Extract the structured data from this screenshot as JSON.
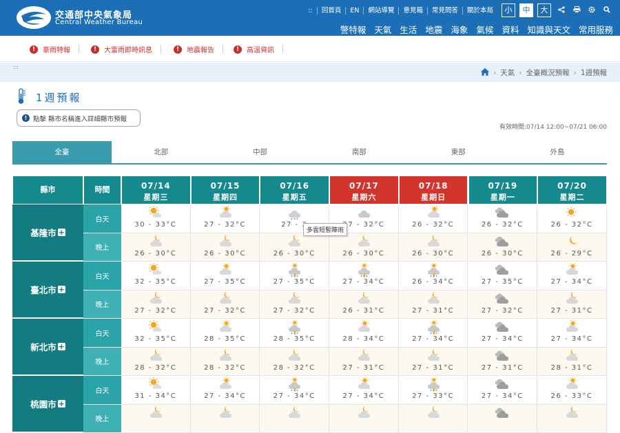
{
  "header": {
    "brand_cn": "交通部中央氣象局",
    "brand_en": "Central Weather Bureau",
    "menu_icon": "::",
    "top_links": [
      "回首頁",
      "EN",
      "網站導覽",
      "意見箱",
      "常見問答",
      "關於本局"
    ],
    "font_sizes": [
      "小",
      "中",
      "大"
    ],
    "font_size_selected": "中",
    "tool_icons": [
      "share-icon",
      "print-icon",
      "gear-icon",
      "search-icon"
    ],
    "nav": [
      "警特報",
      "天氣",
      "生活",
      "地震",
      "海象",
      "氣候",
      "資料",
      "知識與天文",
      "常用服務"
    ],
    "color": "#1c6fb7"
  },
  "alerts": [
    "豪雨特報",
    "大雷雨即時訊息",
    "地震報告",
    "高溫資訊"
  ],
  "breadcrumb": {
    "dots": ":::",
    "items": [
      "天氣",
      "全臺概況預報",
      "1週預報"
    ]
  },
  "page": {
    "title": "1週預報",
    "info_button": "點擊 縣市名稱進入詳細縣市預報",
    "valid_time": "有效時間:07/14 12:00~07/21 06:00"
  },
  "tabs": [
    "全臺",
    "北部",
    "中部",
    "南部",
    "東部",
    "外島"
  ],
  "tab_active": "全臺",
  "table": {
    "col_city": "縣市",
    "col_time": "時間",
    "days": [
      {
        "date": "07/14",
        "weekday": "星期三",
        "holiday": false
      },
      {
        "date": "07/15",
        "weekday": "星期四",
        "holiday": false
      },
      {
        "date": "07/16",
        "weekday": "星期五",
        "holiday": false
      },
      {
        "date": "07/17",
        "weekday": "星期六",
        "holiday": true
      },
      {
        "date": "07/18",
        "weekday": "星期日",
        "holiday": true
      },
      {
        "date": "07/19",
        "weekday": "星期一",
        "holiday": false
      },
      {
        "date": "07/20",
        "weekday": "星期二",
        "holiday": false
      }
    ],
    "day_label": "白天",
    "night_label": "晚上",
    "plus": "+",
    "cities": [
      {
        "name": "基隆市",
        "day": [
          {
            "icon": "sun-cloud",
            "t": "30 - 33°C"
          },
          {
            "icon": "partly-cloudy",
            "t": "27 - 32°C"
          },
          {
            "icon": "cloud-rain",
            "t": "27 - 3"
          },
          {
            "icon": "cloud",
            "t": "27 - 32°C"
          },
          {
            "icon": "partly-cloudy",
            "t": "26 - 32°C"
          },
          {
            "icon": "dark-cloud",
            "t": "26 - 32°C"
          },
          {
            "icon": "sun",
            "t": "26 - 32°C"
          }
        ],
        "night": [
          {
            "icon": "moon-cloud",
            "t": "26 - 30°C"
          },
          {
            "icon": "moon-cloud",
            "t": "26 - 30°C"
          },
          {
            "icon": "moon-cloud",
            "t": "26 - 30°C"
          },
          {
            "icon": "moon-cloud",
            "t": "26 - 30°C"
          },
          {
            "icon": "moon-cloud",
            "t": "26 - 30°C"
          },
          {
            "icon": "dark-cloud",
            "t": "26 - 30°C"
          },
          {
            "icon": "moon",
            "t": "26 - 29°C"
          }
        ]
      },
      {
        "name": "臺北市",
        "day": [
          {
            "icon": "sun-cloud",
            "t": "32 - 35°C"
          },
          {
            "icon": "partly-cloudy",
            "t": "27 - 35°C"
          },
          {
            "icon": "thunder",
            "t": "27 - 35°C"
          },
          {
            "icon": "thunder",
            "t": "27 - 34°C"
          },
          {
            "icon": "thunder",
            "t": "26 - 34°C"
          },
          {
            "icon": "dark-cloud",
            "t": "27 - 35°C"
          },
          {
            "icon": "partly-cloudy",
            "t": "27 - 34°C"
          }
        ],
        "night": [
          {
            "icon": "moon-cloud",
            "t": "27 - 32°C"
          },
          {
            "icon": "moon-cloud",
            "t": "27 - 32°C"
          },
          {
            "icon": "moon-cloud",
            "t": "27 - 32°C"
          },
          {
            "icon": "moon-cloud",
            "t": "26 - 31°C"
          },
          {
            "icon": "moon-cloud",
            "t": "27 - 31°C"
          },
          {
            "icon": "dark-cloud",
            "t": "27 - 32°C"
          },
          {
            "icon": "moon-cloud",
            "t": "27 - 31°C"
          }
        ]
      },
      {
        "name": "新北市",
        "day": [
          {
            "icon": "sun-cloud",
            "t": "32 - 35°C"
          },
          {
            "icon": "partly-cloudy",
            "t": "28 - 35°C"
          },
          {
            "icon": "thunder",
            "t": "28 - 35°C"
          },
          {
            "icon": "partly-cloudy",
            "t": "28 - 34°C"
          },
          {
            "icon": "thunder",
            "t": "27 - 34°C"
          },
          {
            "icon": "dark-cloud",
            "t": "27 - 34°C"
          },
          {
            "icon": "partly-cloudy",
            "t": "27 - 34°C"
          }
        ],
        "night": [
          {
            "icon": "moon-cloud",
            "t": "28 - 32°C"
          },
          {
            "icon": "moon-cloud",
            "t": "28 - 32°C"
          },
          {
            "icon": "moon-cloud",
            "t": "28 - 32°C"
          },
          {
            "icon": "moon-cloud",
            "t": "27 - 31°C"
          },
          {
            "icon": "moon-cloud",
            "t": "27 - 31°C"
          },
          {
            "icon": "dark-cloud",
            "t": "27 - 31°C"
          },
          {
            "icon": "moon-cloud",
            "t": "28 - 31°C"
          }
        ]
      },
      {
        "name": "桃園市",
        "day": [
          {
            "icon": "sun-cloud",
            "t": "31 - 34°C"
          },
          {
            "icon": "partly-cloudy",
            "t": "27 - 34°C"
          },
          {
            "icon": "thunder",
            "t": "27 - 34°C"
          },
          {
            "icon": "partly-cloudy",
            "t": "27 - 34°C"
          },
          {
            "icon": "thunder",
            "t": "27 - 33°C"
          },
          {
            "icon": "dark-cloud",
            "t": "27 - 34°C"
          },
          {
            "icon": "partly-cloudy",
            "t": "26 - 33°C"
          }
        ],
        "night": [
          {
            "icon": "moon-cloud",
            "t": ""
          },
          {
            "icon": "moon-cloud",
            "t": ""
          },
          {
            "icon": "moon-cloud",
            "t": ""
          },
          {
            "icon": "moon-cloud",
            "t": ""
          },
          {
            "icon": "moon-cloud",
            "t": ""
          },
          {
            "icon": "dark-cloud",
            "t": ""
          },
          {
            "icon": "moon-cloud",
            "t": ""
          }
        ]
      }
    ]
  },
  "tooltip": "多雲短暫陣雨",
  "colors": {
    "teal_header": "#148a8f",
    "city": "#127c80",
    "holiday": "#d3342c",
    "tab_active": "#3a9bac",
    "alert": "#c9302c"
  }
}
